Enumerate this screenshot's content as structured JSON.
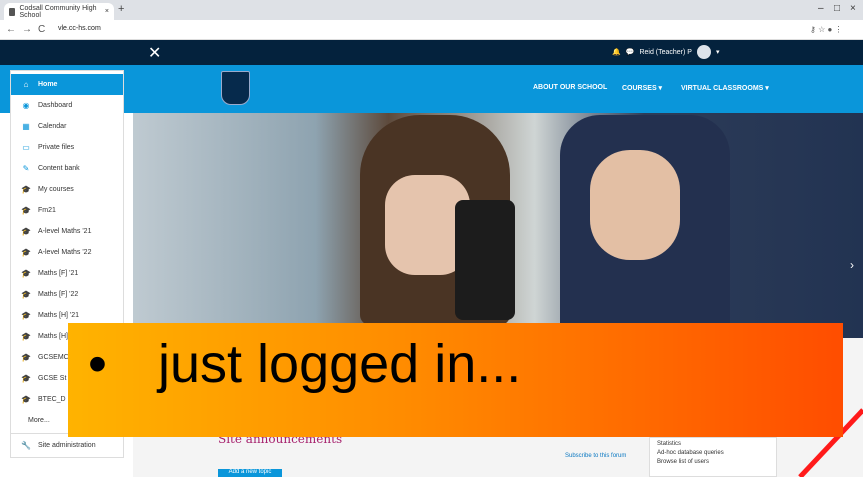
{
  "browser": {
    "tab_title": "Codsall Community High School",
    "tab_close": "×",
    "new_tab": "+",
    "url": "vle.cc-hs.com",
    "nav_back": "←",
    "nav_forward": "→",
    "nav_reload": "C",
    "win_min": "–",
    "win_max": "□",
    "win_close": "×",
    "toolbar_icons": "⚷  ☆  ●  ⋮"
  },
  "header": {
    "close_icon": "✕",
    "user_name": "Reid (Teacher) P",
    "user_caret": "▾",
    "bell_icon": "🔔",
    "chat_icon": "💬"
  },
  "mainnav": {
    "about": "ABOUT OUR SCHOOL",
    "courses": "COURSES ▾",
    "virtual": "VIRTUAL CLASSROOMS ▾"
  },
  "sidebar": {
    "items": [
      {
        "label": "Home",
        "icon": "home-icon",
        "glyph": "⌂"
      },
      {
        "label": "Dashboard",
        "icon": "dashboard-icon",
        "glyph": "◉"
      },
      {
        "label": "Calendar",
        "icon": "calendar-icon",
        "glyph": "▦"
      },
      {
        "label": "Private files",
        "icon": "file-icon",
        "glyph": "▭"
      },
      {
        "label": "Content bank",
        "icon": "pencil-icon",
        "glyph": "✎"
      },
      {
        "label": "My courses",
        "icon": "graduation-cap-icon",
        "glyph": "🎓"
      },
      {
        "label": "Fm21",
        "icon": "graduation-cap-icon",
        "glyph": "🎓"
      },
      {
        "label": "A-level Maths '21",
        "icon": "graduation-cap-icon",
        "glyph": "🎓"
      },
      {
        "label": "A-level Maths '22",
        "icon": "graduation-cap-icon",
        "glyph": "🎓"
      },
      {
        "label": "Maths [F] '21",
        "icon": "graduation-cap-icon",
        "glyph": "🎓"
      },
      {
        "label": "Maths [F] '22",
        "icon": "graduation-cap-icon",
        "glyph": "🎓"
      },
      {
        "label": "Maths [H] '21",
        "icon": "graduation-cap-icon",
        "glyph": "🎓"
      },
      {
        "label": "Maths [H]",
        "icon": "graduation-cap-icon",
        "glyph": "🎓"
      },
      {
        "label": "GCSEMC",
        "icon": "graduation-cap-icon",
        "glyph": "🎓"
      },
      {
        "label": "GCSE St",
        "icon": "graduation-cap-icon",
        "glyph": "🎓"
      },
      {
        "label": "BTEC_D",
        "icon": "graduation-cap-icon",
        "glyph": "🎓"
      },
      {
        "label": "More...",
        "icon": "",
        "glyph": ""
      },
      {
        "label": "Site administration",
        "icon": "wrench-icon",
        "glyph": "🔧"
      }
    ]
  },
  "content": {
    "announcements_title": "Site announcements",
    "subscribe_link": "Subscribe to this forum",
    "add_topic_button": "Add a new topic"
  },
  "reports": {
    "items": [
      "Statistics",
      "Ad-hoc database queries",
      "Browse list of users"
    ]
  },
  "overlay": {
    "bullet": "•",
    "text": "just logged in..."
  },
  "colors": {
    "brand_blue": "#0a96da",
    "dark_navy": "#04223d",
    "announce_color": "#a6216d",
    "overlay_orange": "#ff8a00",
    "annotation_red": "#ff1a1a"
  }
}
